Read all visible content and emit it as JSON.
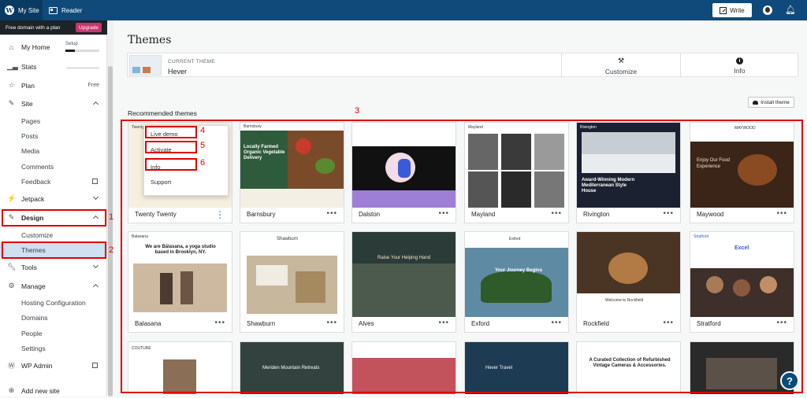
{
  "topbar": {
    "my_site": "My Site",
    "reader": "Reader",
    "write": "Write"
  },
  "sidebar": {
    "promo": "Free domain with a plan",
    "upgrade": "Upgrade",
    "setup": "Setup",
    "items": {
      "my_home": "My Home",
      "stats": "Stats",
      "plan": "Plan",
      "plan_status": "Free",
      "site": "Site",
      "pages": "Pages",
      "posts": "Posts",
      "media": "Media",
      "comments": "Comments",
      "feedback": "Feedback",
      "jetpack": "Jetpack",
      "design": "Design",
      "customize": "Customize",
      "themes": "Themes",
      "tools": "Tools",
      "manage": "Manage",
      "hosting": "Hosting Configuration",
      "domains": "Domains",
      "people": "People",
      "settings": "Settings",
      "wp_admin": "WP Admin",
      "add_site": "Add new site"
    }
  },
  "main": {
    "title": "Themes",
    "current_label": "CURRENT THEME",
    "current_name": "Hever",
    "customize": "Customize",
    "info": "Info",
    "recommended": "Recommended themes",
    "install": "Install theme"
  },
  "menu": {
    "live_demo": "Live demo",
    "activate": "Activate",
    "info": "Info",
    "support": "Support"
  },
  "themes": {
    "t1": "Twenty Twenty",
    "t2": "Barnsbury",
    "t3": "Dalston",
    "t4": "Mayland",
    "t5": "Rivington",
    "t6": "Maywood",
    "t7": "Balasana",
    "t8": "Shawburn",
    "t9": "Alves",
    "t10": "Exford",
    "t11": "Rockfield",
    "t12": "Stratford"
  },
  "shots": {
    "barnsbury": "Locally Farmed Organic Vegetable Delivery",
    "rivington": "Award-Winning Modern Mediterranean Style House",
    "maywood": "Enjoy Our Food Experience",
    "balasana": "We are Bālasana, a yoga studio based in Brooklyn, NY.",
    "exford": "Your Journey Begins",
    "stratford": "Excel",
    "rockfield": "Welcome to Rockfield",
    "alves": "Raise Your Helping Hand",
    "vintage": "A Curated Collection of Refurbished Vintage Cameras & Accessories.",
    "hever": "Hever Travel",
    "meriden": "Meriden Mountain Retreats",
    "couture": "COUTURE",
    "twenty_hdr": "Twenty Twenty",
    "barnsbury_logo": "Barnsbury",
    "mayland_logo": "Mayland",
    "shawburn_logo": "Shawburn",
    "balasana_logo": "Balasana",
    "exford_logo": "Exford",
    "rivington_logo": "Rivington",
    "maywood_logo": "MAYWOOD",
    "stratford_logo": "Stratford"
  },
  "annotations": [
    "1",
    "2",
    "3",
    "4",
    "5",
    "6"
  ],
  "colors": {
    "topbar": "#0f4a7a",
    "accent": "#e00000",
    "upgrade": "#c9356e"
  }
}
